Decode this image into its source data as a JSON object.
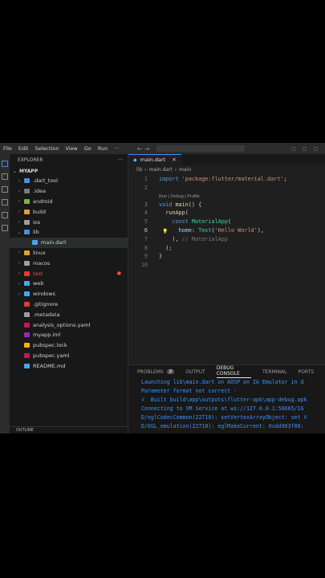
{
  "menu": [
    "File",
    "Edit",
    "Selection",
    "View",
    "Go",
    "Run",
    "···"
  ],
  "explorer": {
    "title": "EXPLORER",
    "more": "···",
    "root": "MYAPP",
    "items": [
      {
        "label": ".dart_tool",
        "chev": "›",
        "indent": 0,
        "icon": "#4a90e2"
      },
      {
        "label": ".idea",
        "chev": "›",
        "indent": 0,
        "icon": "#7a7a7a"
      },
      {
        "label": "android",
        "chev": "›",
        "indent": 0,
        "icon": "#7cb342"
      },
      {
        "label": "build",
        "chev": "›",
        "indent": 0,
        "icon": "#e0a030"
      },
      {
        "label": "ios",
        "chev": "›",
        "indent": 0,
        "icon": "#9e9e9e"
      },
      {
        "label": "lib",
        "chev": "⌄",
        "indent": 0,
        "icon": "#4a90e2"
      },
      {
        "label": "main.dart",
        "chev": "",
        "indent": 1,
        "icon": "#42a5f5",
        "selected": true
      },
      {
        "label": "linux",
        "chev": "›",
        "indent": 0,
        "icon": "#e0a030"
      },
      {
        "label": "macos",
        "chev": "›",
        "indent": 0,
        "icon": "#9e9e9e"
      },
      {
        "label": "test",
        "chev": "›",
        "indent": 0,
        "icon": "#e53935",
        "red": true,
        "dot": "●"
      },
      {
        "label": "web",
        "chev": "›",
        "indent": 0,
        "icon": "#42a5f5"
      },
      {
        "label": "windows",
        "chev": "›",
        "indent": 0,
        "icon": "#42a5f5"
      },
      {
        "label": ".gitignore",
        "chev": "",
        "indent": 0,
        "icon": "#e53935"
      },
      {
        "label": ".metadata",
        "chev": "",
        "indent": 0,
        "icon": "#9e9e9e"
      },
      {
        "label": "analysis_options.yaml",
        "chev": "",
        "indent": 0,
        "icon": "#c2185b"
      },
      {
        "label": "myapp.iml",
        "chev": "",
        "indent": 0,
        "icon": "#9c27b0"
      },
      {
        "label": "pubspec.lock",
        "chev": "",
        "indent": 0,
        "icon": "#ffb300"
      },
      {
        "label": "pubspec.yaml",
        "chev": "",
        "indent": 0,
        "icon": "#c2185b"
      },
      {
        "label": "README.md",
        "chev": "",
        "indent": 0,
        "icon": "#42a5f5"
      }
    ],
    "outline": "OUTLINE"
  },
  "editor": {
    "tab": "main.dart",
    "tab_close": "✕",
    "breadcrumb": [
      "lib",
      "›",
      "main.dart",
      "›",
      "main"
    ],
    "codelens": "Run | Debug | Profile"
  },
  "panel": {
    "tabs": [
      "PROBLEMS",
      "OUTPUT",
      "DEBUG CONSOLE",
      "TERMINAL",
      "PORTS"
    ],
    "problems_count": "2",
    "console": [
      "Launching lib\\main.dart on AOSP on IA Emulator in d",
      "Parameter format not correct -",
      "√  Built build\\app\\outputs\\flutter-apk\\app-debug.apk",
      "Connecting to VM Service at ws://127.0.0.1:58665/1G",
      "D/eglCodecCommon(22710): setVertexArrayObject: set V",
      "D/EGL_emulation(22710): eglMakeCurrent: 0xdd963f00:"
    ]
  },
  "colors": {
    "accent": "#3b8eea",
    "console_text": "#3794ff",
    "error": "#f14c4c"
  }
}
